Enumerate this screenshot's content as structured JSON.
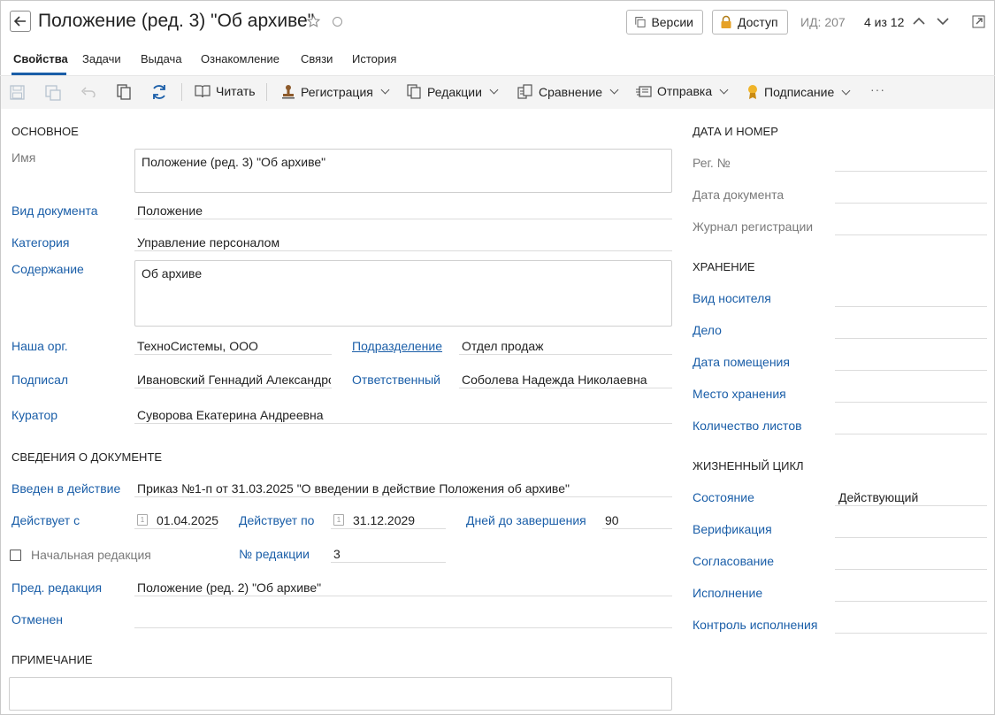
{
  "header": {
    "title": "Положение (ред. 3) \"Об архиве\"",
    "versions_label": "Версии",
    "access_label": "Доступ",
    "id_label": "ИД: 207",
    "pager": "4 из 12"
  },
  "tabs": [
    "Свойства",
    "Задачи",
    "Выдача",
    "Ознакомление",
    "Связи",
    "История"
  ],
  "toolbar": {
    "read": "Читать",
    "registration": "Регистрация",
    "editions": "Редакции",
    "comparison": "Сравнение",
    "sending": "Отправка",
    "signing": "Подписание",
    "more": "···"
  },
  "main": {
    "section_basic": "ОСНОВНОЕ",
    "name_label": "Имя",
    "name_value": "Положение (ред. 3) \"Об архиве\"",
    "doc_type_label": "Вид документа",
    "doc_type_value": "Положение",
    "category_label": "Категория",
    "category_value": "Управление персоналом",
    "content_label": "Содержание",
    "content_value": "Об архиве",
    "org_label": "Наша орг.",
    "org_value": "ТехноСистемы, ООО",
    "dept_label": "Подразделение",
    "dept_value": "Отдел продаж",
    "signed_label": "Подписал",
    "signed_value": "Ивановский Геннадий Александрович",
    "responsible_label": "Ответственный",
    "responsible_value": "Соболева Надежда Николаевна",
    "curator_label": "Куратор",
    "curator_value": "Суворова Екатерина Андреевна",
    "section_info": "СВЕДЕНИЯ О ДОКУМЕНТЕ",
    "introduced_label": "Введен в действие",
    "introduced_value": "Приказ №1-п от 31.03.2025 \"О введении в действие Положения об архиве\"",
    "valid_from_label": "Действует с",
    "valid_from_value": "01.04.2025",
    "valid_to_label": "Действует по",
    "valid_to_value": "31.12.2029",
    "days_left_label": "Дней до завершения",
    "days_left_value": "90",
    "initial_edition_label": "Начальная редакция",
    "edition_no_label": "№ редакции",
    "edition_no_value": "3",
    "prev_edition_label": "Пред. редакция",
    "prev_edition_value": "Положение (ред. 2) \"Об архиве\"",
    "cancelled_label": "Отменен",
    "section_note": "ПРИМЕЧАНИЕ"
  },
  "side": {
    "section_date": "ДАТА И НОМЕР",
    "reg_no": "Рег. №",
    "doc_date": "Дата документа",
    "reg_journal": "Журнал регистрации",
    "section_storage": "ХРАНЕНИЕ",
    "media_type": "Вид носителя",
    "case": "Дело",
    "placement_date": "Дата помещения",
    "storage_place": "Место хранения",
    "sheet_count": "Количество листов",
    "section_lifecycle": "ЖИЗНЕННЫЙ ЦИКЛ",
    "state_label": "Состояние",
    "state_value": "Действующий",
    "verification": "Верификация",
    "approval": "Согласование",
    "execution": "Исполнение",
    "execution_control": "Контроль исполнения"
  },
  "colors": {
    "link": "#1a5ea8",
    "toolbar_bg": "#f4f4f4",
    "lock": "#e6a126",
    "signing": "#f0b429"
  }
}
